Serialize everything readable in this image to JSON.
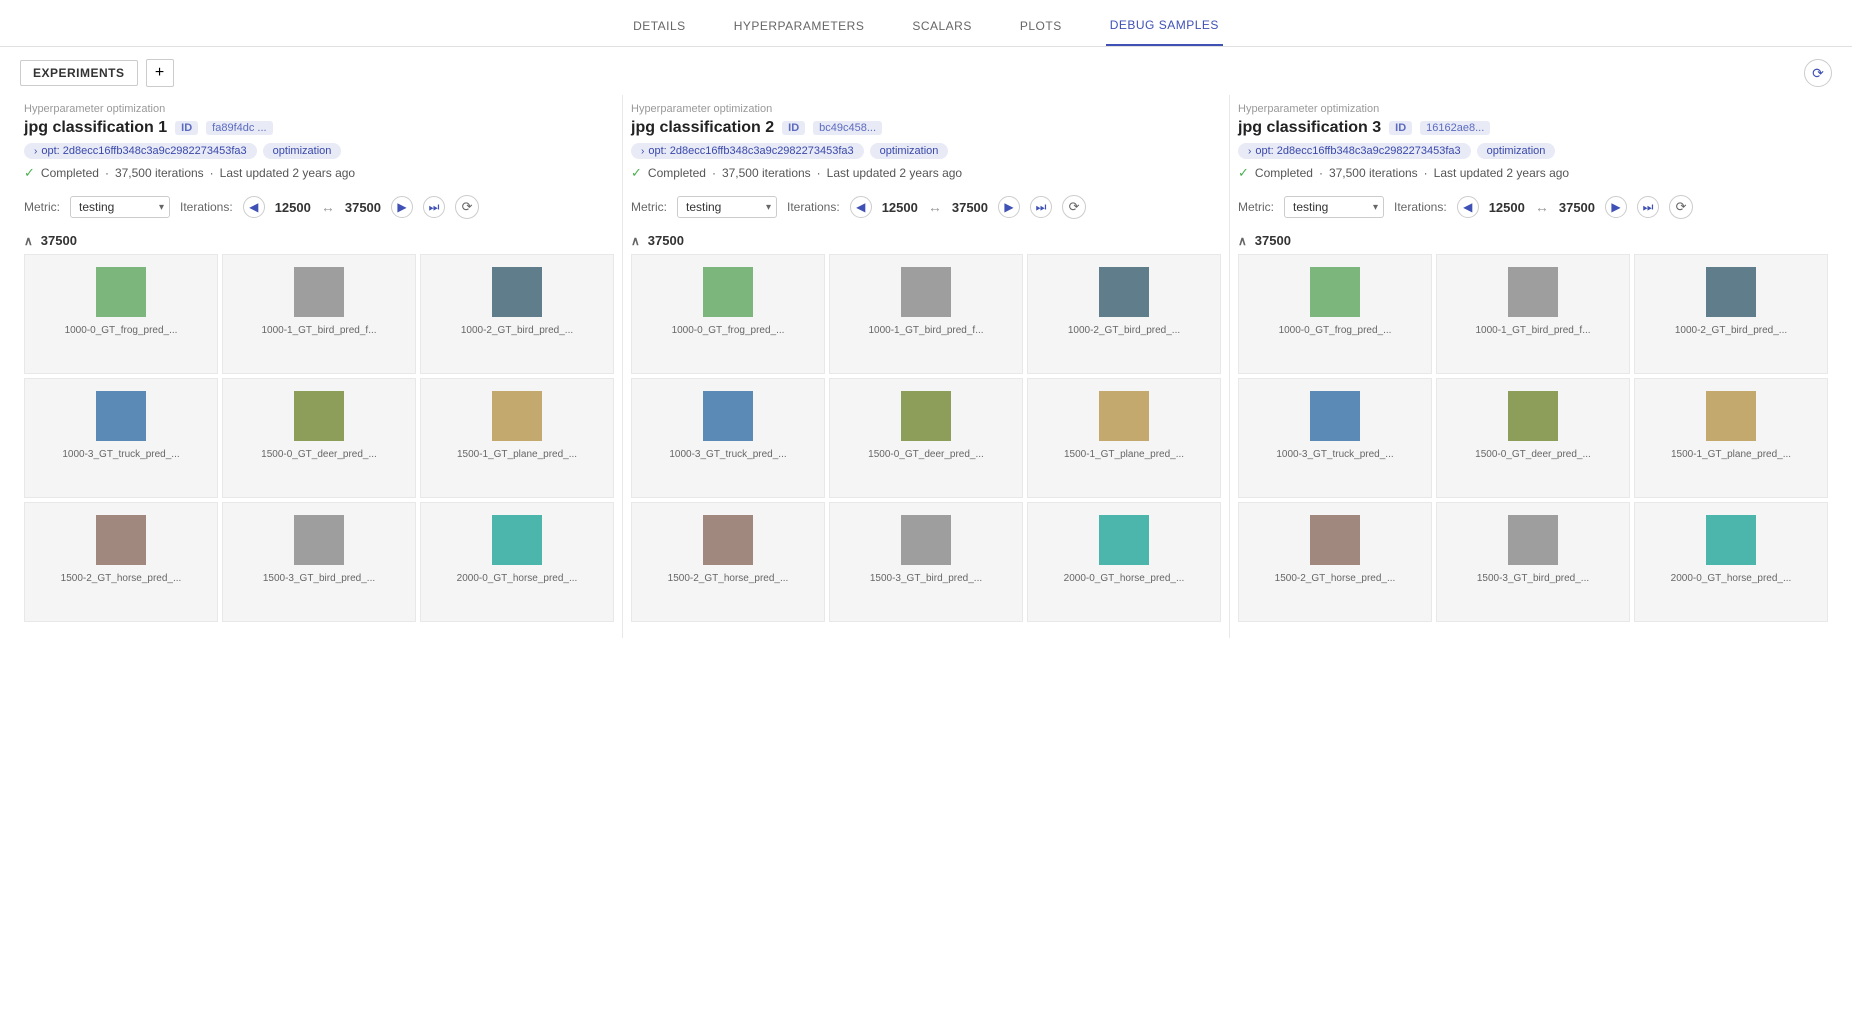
{
  "nav": {
    "items": [
      {
        "id": "details",
        "label": "DETAILS",
        "active": false
      },
      {
        "id": "hyperparameters",
        "label": "HYPERPARAMETERS",
        "active": false
      },
      {
        "id": "scalars",
        "label": "SCALARS",
        "active": false
      },
      {
        "id": "plots",
        "label": "PLOTS",
        "active": false
      },
      {
        "id": "debug-samples",
        "label": "DEBUG SAMPLES",
        "active": true
      }
    ]
  },
  "toolbar": {
    "experiments_label": "EXPERIMENTS",
    "add_label": "+"
  },
  "experiments": [
    {
      "id": "exp1",
      "super_title": "Hyperparameter optimization",
      "title": "jpg classification 1",
      "badge_id": "ID",
      "hash": "fa89f4dc ...",
      "tags": [
        {
          "label": "opt: 2d8ecc16ffb348c3a9c2982273453fa3",
          "arrow": true
        },
        {
          "label": "optimization",
          "arrow": false
        }
      ],
      "status": "Completed",
      "iterations": "37,500 iterations",
      "last_updated": "Last updated 2 years ago",
      "metric": {
        "label": "Metric:",
        "value": "testing",
        "options": [
          "testing"
        ]
      },
      "iter_label": "Iterations:",
      "iter_start": "12500",
      "iter_end": "37500",
      "section_value": "37500",
      "images": [
        {
          "label": "1000-0_GT_frog_pred_...",
          "color": "thumb-green"
        },
        {
          "label": "1000-1_GT_bird_pred_f...",
          "color": "thumb-gray"
        },
        {
          "label": "1000-2_GT_bird_pred_...",
          "color": "thumb-dark"
        },
        {
          "label": "1000-3_GT_truck_pred_...",
          "color": "thumb-blue"
        },
        {
          "label": "1500-0_GT_deer_pred_...",
          "color": "thumb-olive"
        },
        {
          "label": "1500-1_GT_plane_pred_...",
          "color": "thumb-tan"
        },
        {
          "label": "1500-2_GT_horse_pred_...",
          "color": "thumb-brown"
        },
        {
          "label": "1500-3_GT_bird_pred_...",
          "color": "thumb-gray"
        },
        {
          "label": "2000-0_GT_horse_pred_...",
          "color": "thumb-teal"
        }
      ]
    },
    {
      "id": "exp2",
      "super_title": "Hyperparameter optimization",
      "title": "jpg classification 2",
      "badge_id": "ID",
      "hash": "bc49c458...",
      "tags": [
        {
          "label": "opt: 2d8ecc16ffb348c3a9c2982273453fa3",
          "arrow": true
        },
        {
          "label": "optimization",
          "arrow": false
        }
      ],
      "status": "Completed",
      "iterations": "37,500 iterations",
      "last_updated": "Last updated 2 years ago",
      "metric": {
        "label": "Metric:",
        "value": "testing",
        "options": [
          "testing"
        ]
      },
      "iter_label": "Iterations:",
      "iter_start": "12500",
      "iter_end": "37500",
      "section_value": "37500",
      "images": [
        {
          "label": "1000-0_GT_frog_pred_...",
          "color": "thumb-green"
        },
        {
          "label": "1000-1_GT_bird_pred_f...",
          "color": "thumb-gray"
        },
        {
          "label": "1000-2_GT_bird_pred_...",
          "color": "thumb-dark"
        },
        {
          "label": "1000-3_GT_truck_pred_...",
          "color": "thumb-blue"
        },
        {
          "label": "1500-0_GT_deer_pred_...",
          "color": "thumb-olive"
        },
        {
          "label": "1500-1_GT_plane_pred_...",
          "color": "thumb-tan"
        },
        {
          "label": "1500-2_GT_horse_pred_...",
          "color": "thumb-brown"
        },
        {
          "label": "1500-3_GT_bird_pred_...",
          "color": "thumb-gray"
        },
        {
          "label": "2000-0_GT_horse_pred_...",
          "color": "thumb-teal"
        }
      ]
    },
    {
      "id": "exp3",
      "super_title": "Hyperparameter optimization",
      "title": "jpg classification 3",
      "badge_id": "ID",
      "hash": "16162ae8...",
      "tags": [
        {
          "label": "opt: 2d8ecc16ffb348c3a9c2982273453fa3",
          "arrow": true
        },
        {
          "label": "optimization",
          "arrow": false
        }
      ],
      "status": "Completed",
      "iterations": "37,500 iterations",
      "last_updated": "Last updated 2 years ago",
      "metric": {
        "label": "Metric:",
        "value": "testing",
        "options": [
          "testing"
        ]
      },
      "iter_label": "Iterations:",
      "iter_start": "12500",
      "iter_end": "37500",
      "section_value": "37500",
      "images": [
        {
          "label": "1000-0_GT_frog_pred_...",
          "color": "thumb-green"
        },
        {
          "label": "1000-1_GT_bird_pred_f...",
          "color": "thumb-gray"
        },
        {
          "label": "1000-2_GT_bird_pred_...",
          "color": "thumb-dark"
        },
        {
          "label": "1000-3_GT_truck_pred_...",
          "color": "thumb-blue"
        },
        {
          "label": "1500-0_GT_deer_pred_...",
          "color": "thumb-olive"
        },
        {
          "label": "1500-1_GT_plane_pred_...",
          "color": "thumb-tan"
        },
        {
          "label": "1500-2_GT_horse_pred_...",
          "color": "thumb-brown"
        },
        {
          "label": "1500-3_GT_bird_pred_...",
          "color": "thumb-gray"
        },
        {
          "label": "2000-0_GT_horse_pred_...",
          "color": "thumb-teal"
        }
      ]
    }
  ],
  "icons": {
    "prev": "◀",
    "next": "▶",
    "end": "⏭",
    "sync": "⟳",
    "collapse": "∧",
    "refresh": "⟳",
    "check": "✓",
    "range": "↔"
  }
}
